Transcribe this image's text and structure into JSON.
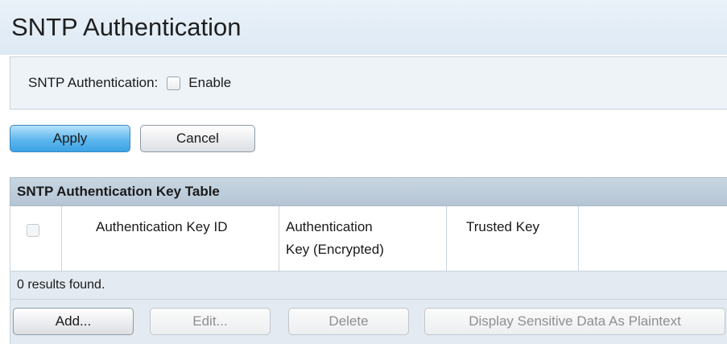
{
  "page": {
    "title": "SNTP Authentication"
  },
  "settings": {
    "auth_label": "SNTP Authentication:",
    "enable_label": "Enable",
    "enabled": false
  },
  "actions": {
    "apply": "Apply",
    "cancel": "Cancel"
  },
  "key_table": {
    "title": "SNTP Authentication Key Table",
    "columns": {
      "key_id": "Authentication Key ID",
      "key_enc_line1": "Authentication",
      "key_enc_line2": "Key (Encrypted)",
      "trusted": "Trusted Key"
    },
    "results_text": "0 results found.",
    "buttons": {
      "add": "Add...",
      "edit": "Edit...",
      "delete": "Delete",
      "display": "Display Sensitive Data As Plaintext"
    }
  }
}
